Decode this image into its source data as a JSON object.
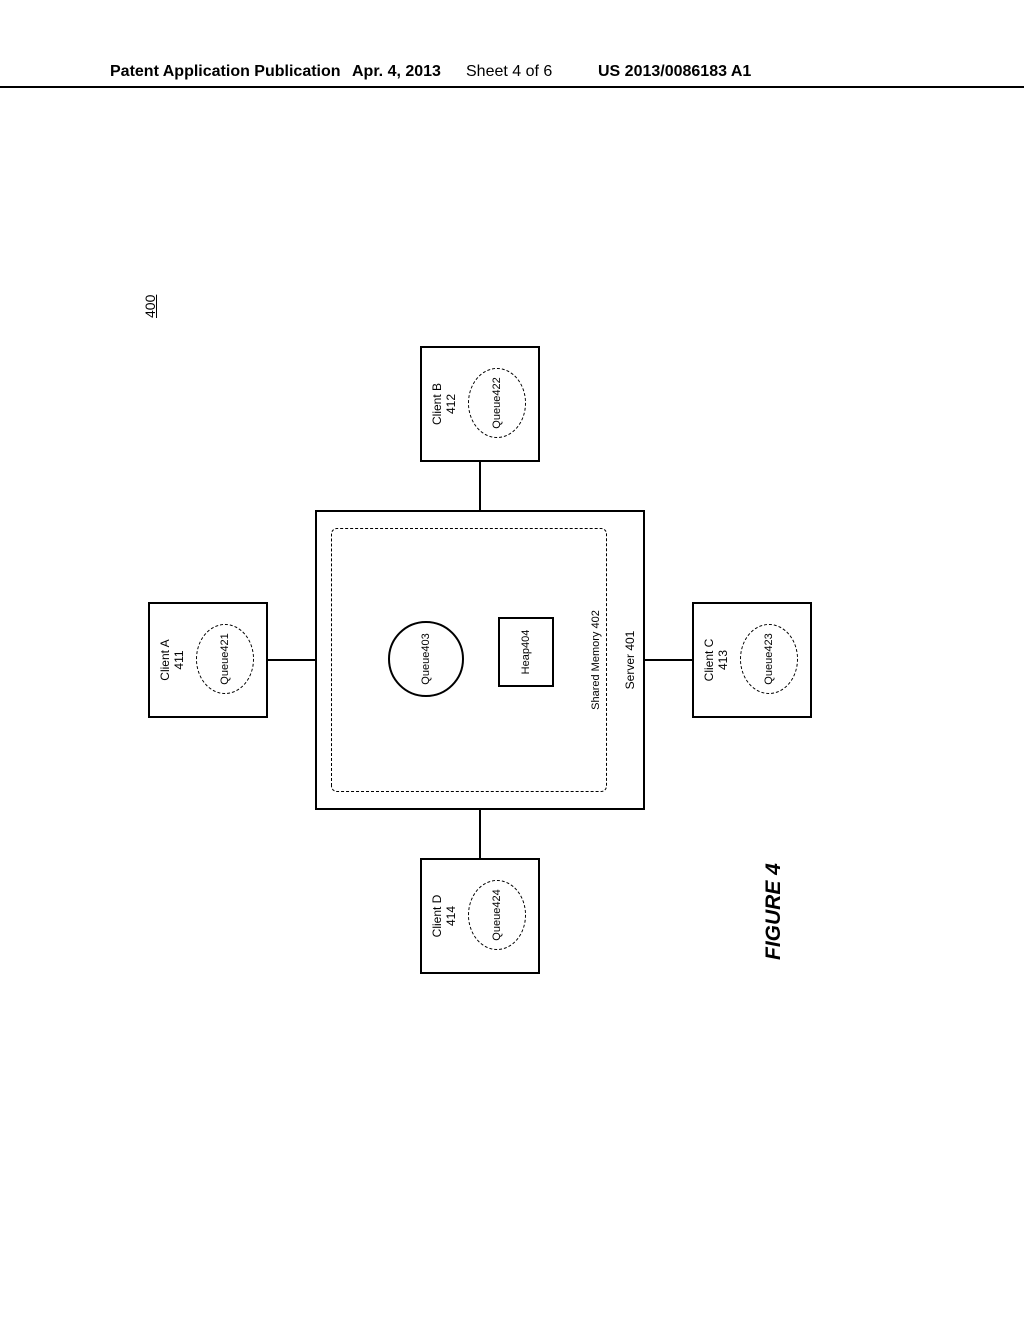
{
  "header": {
    "publication_label": "Patent Application Publication",
    "date": "Apr. 4, 2013",
    "sheet": "Sheet 4 of 6",
    "pub_number": "US 2013/0086183 A1"
  },
  "diagram": {
    "reference_number": "400",
    "server": {
      "label": "Server 401",
      "shared_memory_label": "Shared Memory 402",
      "queue": {
        "name": "Queue",
        "number": "403"
      },
      "heap": {
        "name": "Heap",
        "number": "404"
      }
    },
    "clients": {
      "top": {
        "name": "Client A",
        "number": "411",
        "queue_name": "Queue",
        "queue_number": "421"
      },
      "right": {
        "name": "Client B",
        "number": "412",
        "queue_name": "Queue",
        "queue_number": "422"
      },
      "bottom": {
        "name": "Client C",
        "number": "413",
        "queue_name": "Queue",
        "queue_number": "423"
      },
      "left": {
        "name": "Client D",
        "number": "414",
        "queue_name": "Queue",
        "queue_number": "424"
      }
    }
  },
  "caption": "FIGURE 4"
}
